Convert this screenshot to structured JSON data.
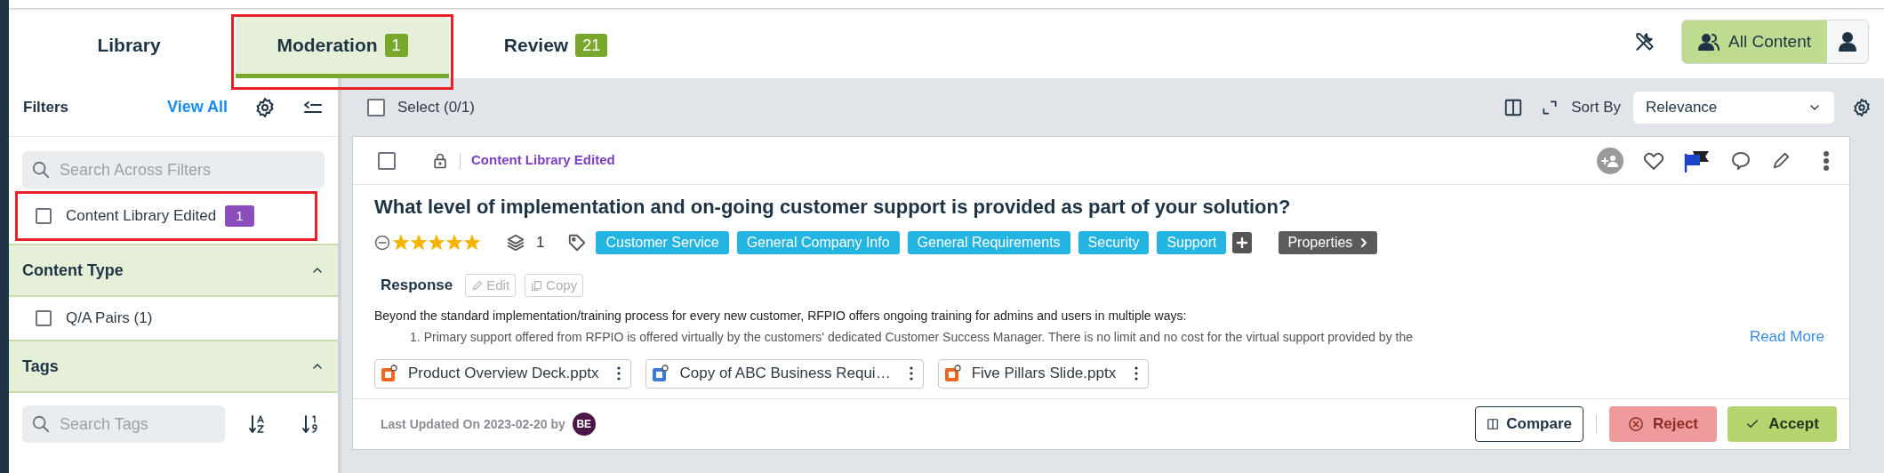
{
  "tabs": [
    {
      "label": "Library",
      "selected": false,
      "highlighted": false
    },
    {
      "label": "Moderation",
      "count": "1",
      "selected": true,
      "highlighted": true
    },
    {
      "label": "Review",
      "count": "21",
      "selected": false,
      "highlighted": false
    }
  ],
  "view_toggle": {
    "label": "All Content",
    "selected": true
  },
  "filters": {
    "title": "Filters",
    "view_all": "View All",
    "search": {
      "placeholder": "Search Across Filters"
    },
    "items": [
      {
        "label": "Content Library Edited",
        "count": "1",
        "checked": false,
        "highlighted": true
      }
    ],
    "sections": [
      {
        "title": "Content Type",
        "expanded": true,
        "options": [
          {
            "label": "Q/A Pairs (1)",
            "checked": false
          }
        ]
      },
      {
        "title": "Tags",
        "expanded": true,
        "search": {
          "placeholder": "Search Tags"
        }
      }
    ]
  },
  "toolbar": {
    "select_label": "Select (0/1)",
    "select_checked": false,
    "sort_label": "Sort By",
    "sort_value": "Relevance"
  },
  "card": {
    "checked": false,
    "status": "Content Library Edited",
    "question": "What level of implementation and on-going customer support is provided as part of your solution?",
    "stars": 5,
    "versions": "1",
    "tags": [
      "Customer Service",
      "General Company Info",
      "General Requirements",
      "Security",
      "Support"
    ],
    "properties": "Properties",
    "response_label": "Response",
    "edit": "Edit",
    "copy": "Copy",
    "response_text": "Beyond the standard implementation/training process for every new customer, RFPIO offers ongoing training for admins and users in multiple ways:",
    "response_list": [
      {
        "number": "1.",
        "text": "Primary support offered from RFPIO is offered virtually by the customers' dedicated Customer Success Manager. There is no limit and no cost for the virtual support provided by the"
      }
    ],
    "read_more": "Read More",
    "attachments": [
      {
        "name": "Product Overview Deck.pptx",
        "kind": "slides"
      },
      {
        "name": "Copy of ABC Business Requi…",
        "kind": "document"
      },
      {
        "name": "Five Pillars Slide.pptx",
        "kind": "slides"
      }
    ],
    "updated": "Last Updated On 2023-02-20 by",
    "author_initials": "BE",
    "compare": "Compare",
    "reject": "Reject",
    "accept": "Accept"
  }
}
